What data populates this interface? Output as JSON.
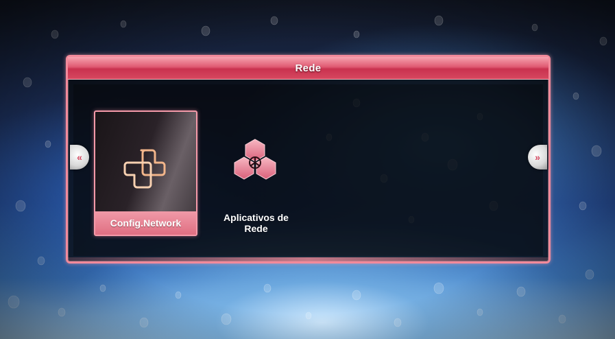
{
  "header": {
    "title": "Rede"
  },
  "menu": {
    "items": [
      {
        "label": "Config.Network",
        "icon": "network-config-icon",
        "selected": true
      },
      {
        "label": "Aplicativos de Rede",
        "icon": "network-apps-icon",
        "selected": false
      }
    ]
  },
  "nav": {
    "left_glyph": "«",
    "right_glyph": "»"
  },
  "colors": {
    "accent": "#e05a72",
    "highlight": "#f59aa9",
    "text": "#ffffff"
  }
}
